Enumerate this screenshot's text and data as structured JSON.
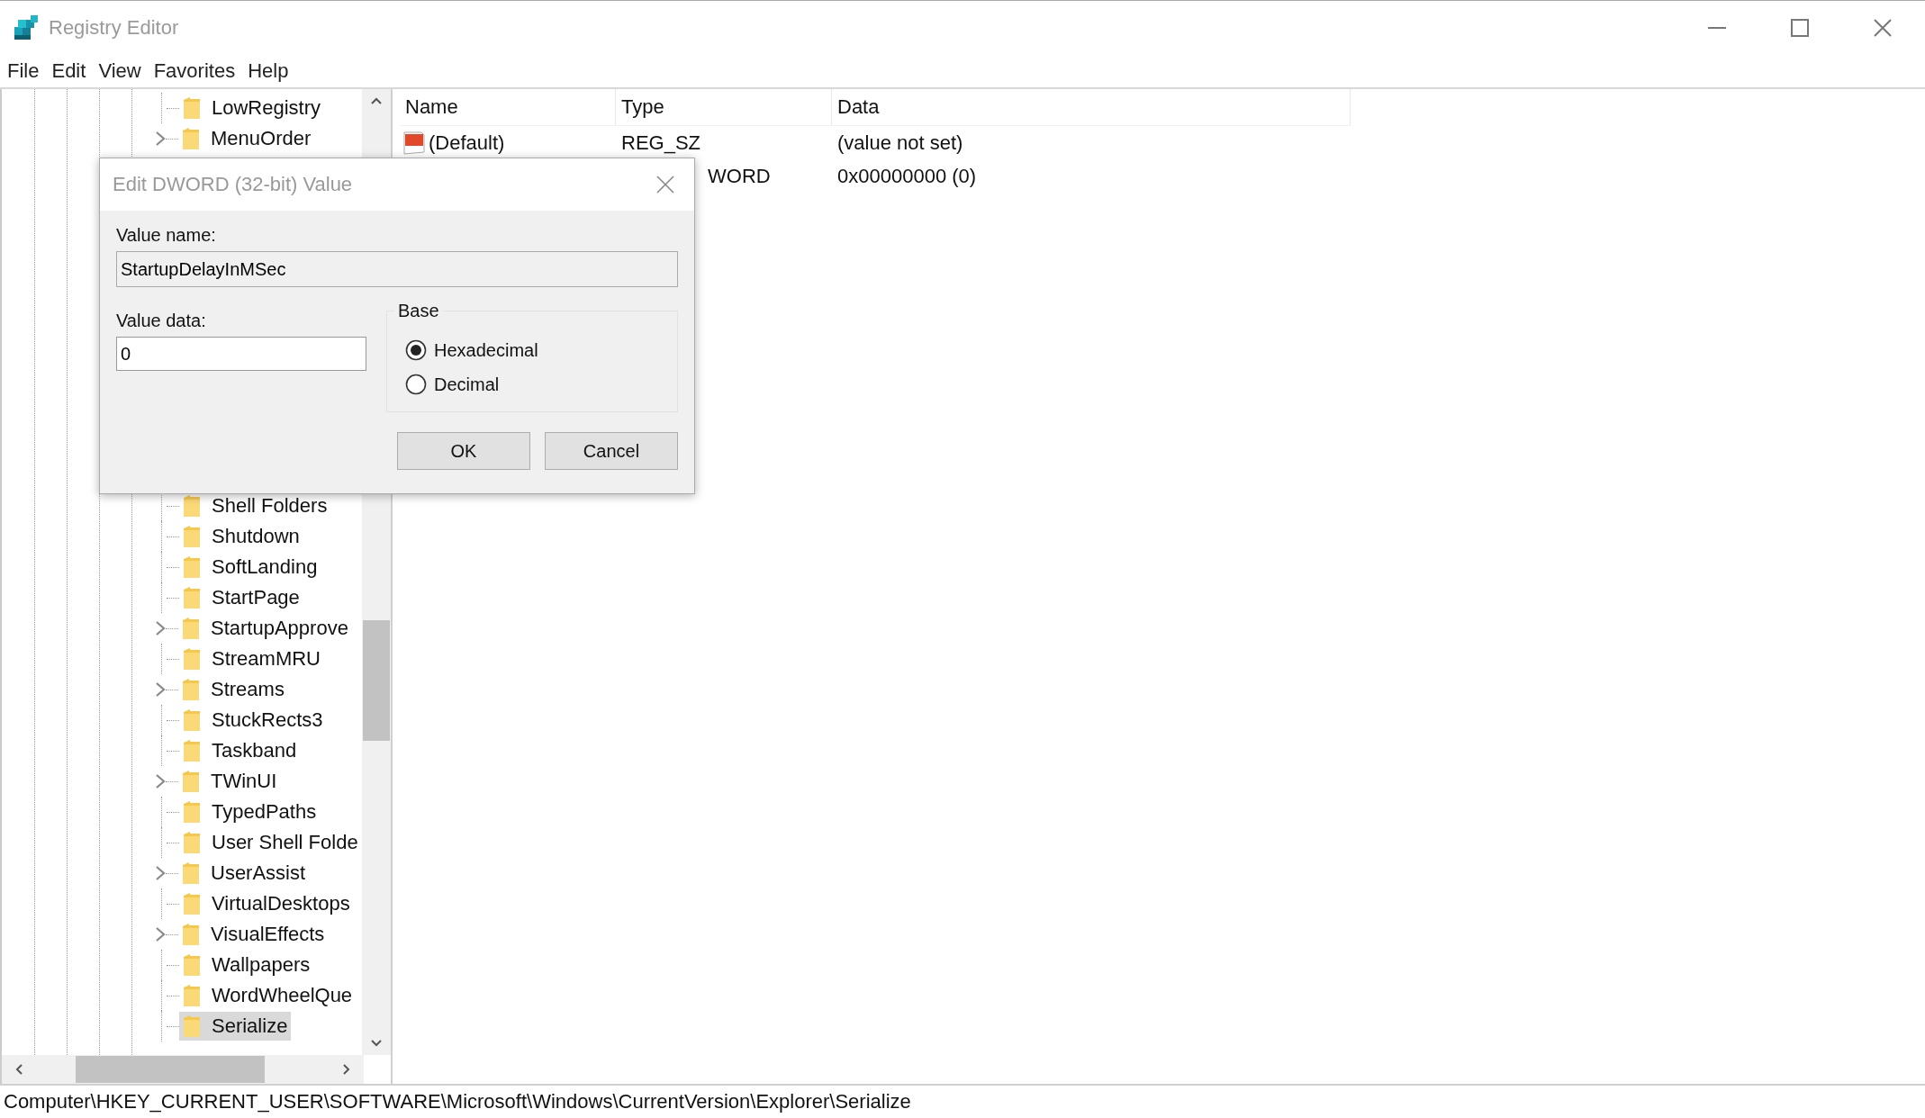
{
  "window": {
    "title": "Registry Editor"
  },
  "menu": [
    "File",
    "Edit",
    "View",
    "Favorites",
    "Help"
  ],
  "tree": {
    "items_above": [
      {
        "label": "LowRegistry",
        "expandable": false,
        "selected": false
      },
      {
        "label": "MenuOrder",
        "expandable": true,
        "selected": false
      }
    ],
    "items_below": [
      {
        "label": "Shell Folders",
        "expandable": false,
        "selected": false
      },
      {
        "label": "Shutdown",
        "expandable": false,
        "selected": false
      },
      {
        "label": "SoftLanding",
        "expandable": false,
        "selected": false
      },
      {
        "label": "StartPage",
        "expandable": false,
        "selected": false
      },
      {
        "label": "StartupApprove",
        "expandable": true,
        "selected": false
      },
      {
        "label": "StreamMRU",
        "expandable": false,
        "selected": false
      },
      {
        "label": "Streams",
        "expandable": true,
        "selected": false
      },
      {
        "label": "StuckRects3",
        "expandable": false,
        "selected": false
      },
      {
        "label": "Taskband",
        "expandable": false,
        "selected": false
      },
      {
        "label": "TWinUI",
        "expandable": true,
        "selected": false
      },
      {
        "label": "TypedPaths",
        "expandable": false,
        "selected": false
      },
      {
        "label": "User Shell Folde",
        "expandable": false,
        "selected": false
      },
      {
        "label": "UserAssist",
        "expandable": true,
        "selected": false
      },
      {
        "label": "VirtualDesktops",
        "expandable": false,
        "selected": false
      },
      {
        "label": "VisualEffects",
        "expandable": true,
        "selected": false
      },
      {
        "label": "Wallpapers",
        "expandable": false,
        "selected": false
      },
      {
        "label": "WordWheelQue",
        "expandable": false,
        "selected": false
      },
      {
        "label": "Serialize",
        "expandable": false,
        "selected": true
      }
    ]
  },
  "values": {
    "columns": [
      "Name",
      "Type",
      "Data"
    ],
    "rows": [
      {
        "name": "(Default)",
        "type": "REG_SZ",
        "data": "(value not set)",
        "kind": "string"
      },
      {
        "type": "WORD",
        "data": "0x00000000 (0)",
        "kind": "hidden"
      }
    ]
  },
  "dialog": {
    "title": "Edit DWORD (32-bit) Value",
    "value_name_label": "Value name:",
    "value_name": "StartupDelayInMSec",
    "value_data_label": "Value data:",
    "value_data": "0",
    "base_label": "Base",
    "bases": [
      {
        "label": "Hexadecimal",
        "selected": true
      },
      {
        "label": "Decimal",
        "selected": false
      }
    ],
    "buttons": [
      "OK",
      "Cancel"
    ]
  },
  "status_bar": "Computer\\HKEY_CURRENT_USER\\SOFTWARE\\Microsoft\\Windows\\CurrentVersion\\Explorer\\Serialize"
}
